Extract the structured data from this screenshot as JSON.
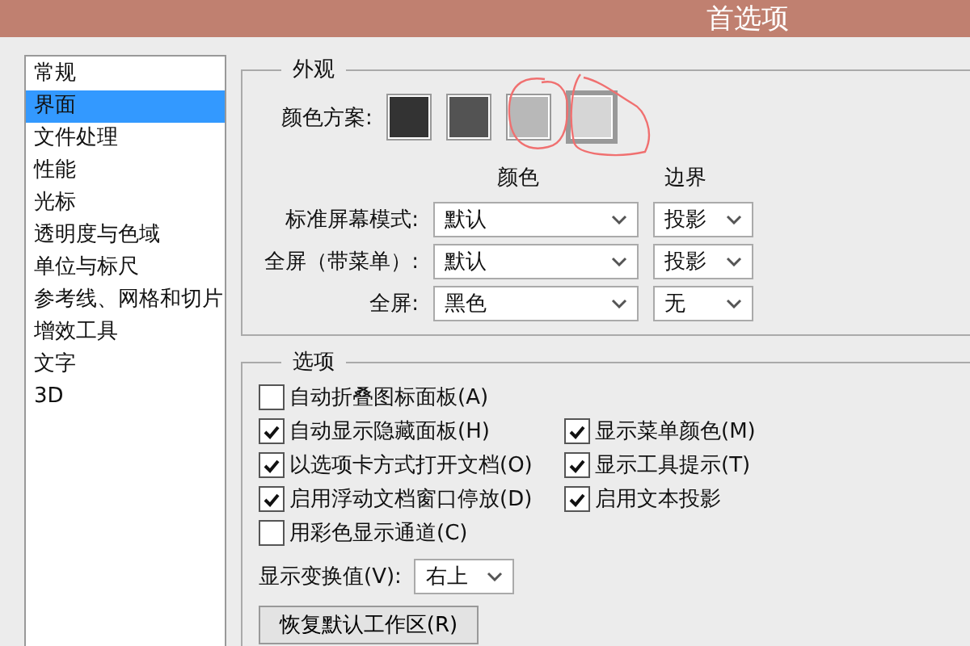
{
  "window": {
    "title": "首选项"
  },
  "sidebar": {
    "items": [
      {
        "label": "常规",
        "selected": false
      },
      {
        "label": "界面",
        "selected": true
      },
      {
        "label": "文件处理",
        "selected": false
      },
      {
        "label": "性能",
        "selected": false
      },
      {
        "label": "光标",
        "selected": false
      },
      {
        "label": "透明度与色域",
        "selected": false
      },
      {
        "label": "单位与标尺",
        "selected": false
      },
      {
        "label": "参考线、网格和切片",
        "selected": false
      },
      {
        "label": "增效工具",
        "selected": false
      },
      {
        "label": "文字",
        "selected": false
      },
      {
        "label": "3D",
        "selected": false
      }
    ]
  },
  "appearance": {
    "legend": "外观",
    "scheme_label": "颜色方案:",
    "swatches": [
      {
        "color": "#333333",
        "selected": false
      },
      {
        "color": "#535353",
        "selected": false
      },
      {
        "color": "#b8b8b8",
        "selected": false
      },
      {
        "color": "#d6d6d6",
        "selected": true
      }
    ],
    "column_headers": [
      "颜色",
      "边界"
    ],
    "rows": [
      {
        "label": "标准屏幕模式:",
        "color_setting": "默认",
        "border": "投影"
      },
      {
        "label": "全屏（带菜单）:",
        "color_setting": "默认",
        "border": "投影"
      },
      {
        "label": "全屏:",
        "color_setting": "黑色",
        "border": "无"
      }
    ]
  },
  "options": {
    "legend": "选项",
    "rows": [
      [
        {
          "label": "自动折叠图标面板(A)",
          "checked": false
        }
      ],
      [
        {
          "label": "自动显示隐藏面板(H)",
          "checked": true
        },
        {
          "label": "显示菜单颜色(M)",
          "checked": true
        }
      ],
      [
        {
          "label": "以选项卡方式打开文档(O)",
          "checked": true
        },
        {
          "label": "显示工具提示(T)",
          "checked": true
        }
      ],
      [
        {
          "label": "启用浮动文档窗口停放(D)",
          "checked": true
        },
        {
          "label": "启用文本投影",
          "checked": true
        }
      ],
      [
        {
          "label": "用彩色显示通道(C)",
          "checked": false
        }
      ]
    ],
    "transform_label": "显示变换值(V):",
    "transform_value": "右上",
    "reset_button": "恢复默认工作区(R)"
  }
}
